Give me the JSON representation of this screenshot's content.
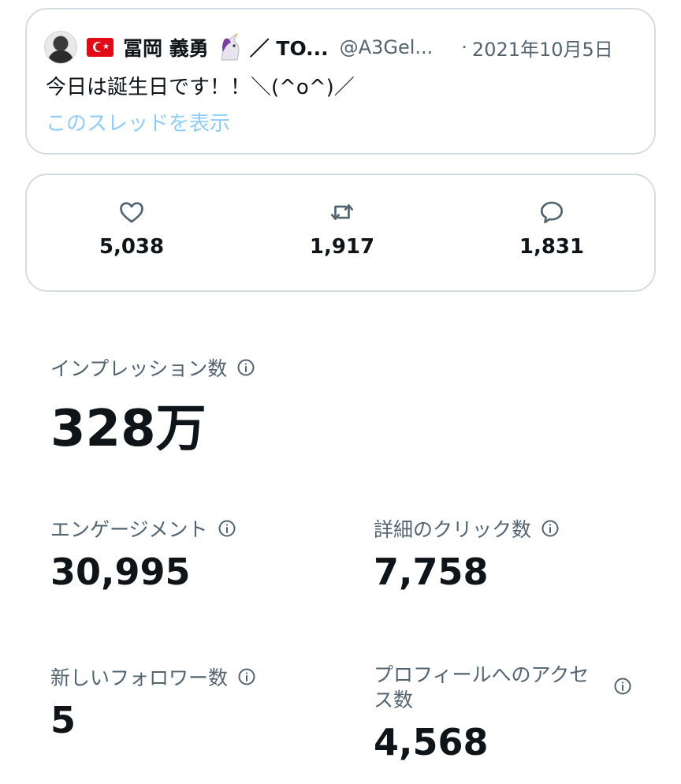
{
  "tweet": {
    "display_name": "冨岡 義勇",
    "name_suffix": "／ TO...",
    "handle": "@A3Gel...",
    "dot": "·",
    "date": "2021年10月5日",
    "text": "今日は誕生日です！！＼(^o^)／",
    "thread_link": "このスレッドを表示",
    "icons": [
      "avatar",
      "turkey-flag-icon",
      "unicorn-icon"
    ]
  },
  "stats": {
    "likes": "5,038",
    "retweets": "1,917",
    "replies": "1,831",
    "icons": [
      "heart-icon",
      "retweet-icon",
      "reply-icon"
    ]
  },
  "metrics": {
    "impressions": {
      "label": "インプレッション数",
      "value": "328万"
    },
    "engagements": {
      "label": "エンゲージメント",
      "value": "30,995"
    },
    "detail_clicks": {
      "label": "詳細のクリック数",
      "value": "7,758"
    },
    "new_followers": {
      "label": "新しいフォロワー数",
      "value": "5"
    },
    "profile_visits": {
      "label": "プロフィールへのアクセス数",
      "value": "4,568"
    },
    "icon": "info-icon"
  },
  "colors": {
    "text_primary": "#0f1419",
    "text_secondary": "#536471",
    "link": "#8ecdf8",
    "border": "#d6dde2",
    "flag_red": "#e30a17"
  }
}
